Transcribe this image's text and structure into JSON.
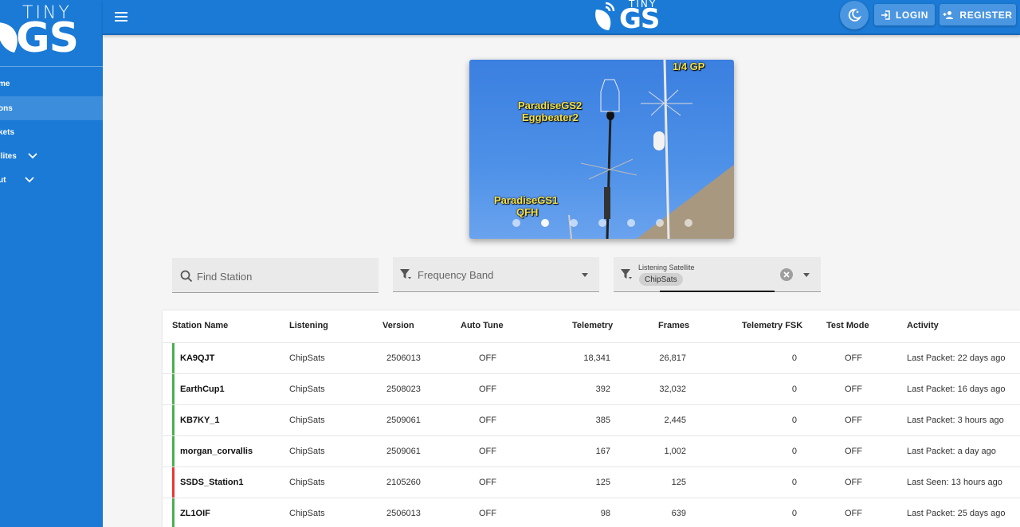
{
  "brand": {
    "tiny": "TINY",
    "gs": "GS"
  },
  "sidebar": {
    "items": [
      {
        "label": "me",
        "active": false
      },
      {
        "label": "ons",
        "active": true
      },
      {
        "label": "kets",
        "active": false
      },
      {
        "label": "llites",
        "active": false,
        "expandable": true
      },
      {
        "label": "ut",
        "active": false,
        "expandable": true
      }
    ]
  },
  "topbar": {
    "login_label": "LOGIN",
    "register_label": "REGISTER"
  },
  "carousel": {
    "annotations": [
      "1/4 GP",
      "ParadiseGS2",
      "Eggbeater2",
      "ParadiseGS1",
      "QFH"
    ],
    "slide_count": 7,
    "active_slide": 1
  },
  "filters": {
    "search_placeholder": "Find Station",
    "band_placeholder": "Frequency Band",
    "satellite_label": "Listening Satellite",
    "satellite_chip": "ChipSats"
  },
  "table": {
    "headers": [
      "Station Name",
      "Listening",
      "Version",
      "Auto Tune",
      "Telemetry",
      "Frames",
      "Telemetry FSK",
      "Test Mode",
      "Activity"
    ],
    "rows": [
      {
        "name": "KA9QJT",
        "listening": "ChipSats",
        "version": "2506013",
        "auto_tune": "OFF",
        "telemetry": "18,341",
        "frames": "26,817",
        "telemetry_fsk": "0",
        "test_mode": "OFF",
        "activity": "Last Packet: 22 days ago",
        "status_color": "#4caf50"
      },
      {
        "name": "EarthCup1",
        "listening": "ChipSats",
        "version": "2508023",
        "auto_tune": "OFF",
        "telemetry": "392",
        "frames": "32,032",
        "telemetry_fsk": "0",
        "test_mode": "OFF",
        "activity": "Last Packet: 16 days ago",
        "status_color": "#4caf50"
      },
      {
        "name": "KB7KY_1",
        "listening": "ChipSats",
        "version": "2509061",
        "auto_tune": "OFF",
        "telemetry": "385",
        "frames": "2,445",
        "telemetry_fsk": "0",
        "test_mode": "OFF",
        "activity": "Last Packet: 3 hours ago",
        "status_color": "#4caf50"
      },
      {
        "name": "morgan_corvallis",
        "listening": "ChipSats",
        "version": "2509061",
        "auto_tune": "OFF",
        "telemetry": "167",
        "frames": "1,002",
        "telemetry_fsk": "0",
        "test_mode": "OFF",
        "activity": "Last Packet: a day ago",
        "status_color": "#4caf50"
      },
      {
        "name": "SSDS_Station1",
        "listening": "ChipSats",
        "version": "2105260",
        "auto_tune": "OFF",
        "telemetry": "125",
        "frames": "125",
        "telemetry_fsk": "0",
        "test_mode": "OFF",
        "activity": "Last Seen: 13 hours ago",
        "status_color": "#e53935"
      },
      {
        "name": "ZL1OIF",
        "listening": "ChipSats",
        "version": "2506013",
        "auto_tune": "OFF",
        "telemetry": "98",
        "frames": "639",
        "telemetry_fsk": "0",
        "test_mode": "OFF",
        "activity": "Last Packet: 25 days ago",
        "status_color": "#4caf50"
      }
    ]
  },
  "colors": {
    "primary": "#1a7ad6",
    "online": "#4caf50",
    "offline": "#e53935"
  }
}
